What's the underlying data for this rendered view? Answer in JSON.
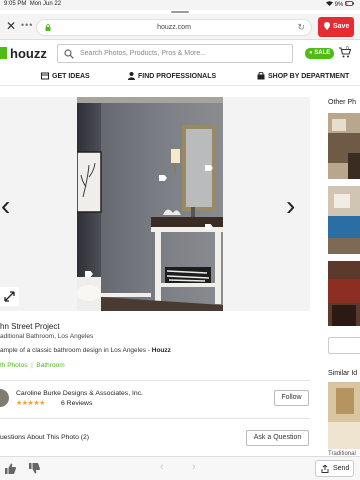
{
  "status_bar": {
    "time": "9:05 PM",
    "date": "Mon Jun 22",
    "battery": "9%"
  },
  "browser": {
    "host": "houzz.com",
    "save_label": "Save",
    "accent": "#e52b34"
  },
  "header": {
    "logo_text": "houzz",
    "search_placeholder": "Search Photos, Products, Pros & More...",
    "sale_badge": "SALE",
    "cart_count": "0",
    "brand_color": "#4dbc15"
  },
  "nav": {
    "items": [
      "GET IDEAS",
      "FIND PROFESSIONALS",
      "SHOP BY DEPARTMENT"
    ]
  },
  "photo": {
    "title": "hn Street Project",
    "subtitle": "aditional Bathroom, Los Angeles",
    "description_prefix": "ample of a classic bathroom design in Los Angeles - ",
    "description_brand": "Houzz",
    "categories": [
      "th Photos",
      "Bathroom"
    ]
  },
  "pro": {
    "name": "Caroline Burke Designs & Associates, Inc.",
    "stars": "★★★★★",
    "reviews": "6 Reviews",
    "follow_label": "Follow"
  },
  "questions": {
    "title": "uestions About This Photo (2)",
    "ask_label": "Ask a Question"
  },
  "sidebar": {
    "title": "Other Ph",
    "similar": "Similar Id",
    "bottom_label": "Traditional"
  },
  "bottombar": {
    "send_label": "Send"
  }
}
